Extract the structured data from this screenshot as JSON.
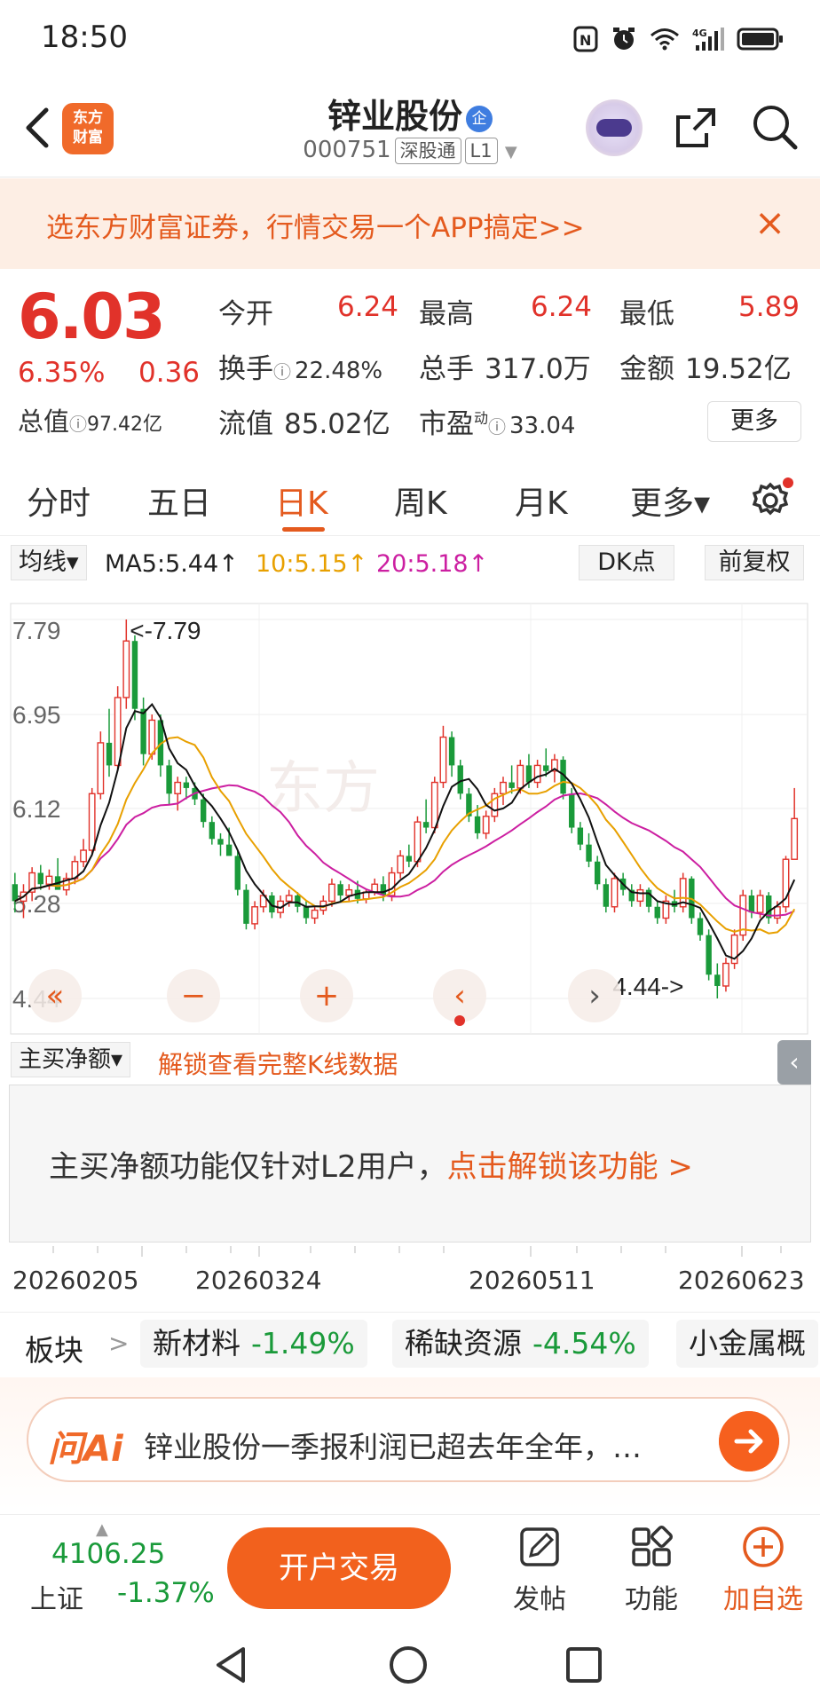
{
  "status_bar": {
    "time": "18:50",
    "network": "4G"
  },
  "nav": {
    "logo_text_line1": "东方",
    "logo_text_line2": "财富",
    "stock_name": "锌业股份",
    "badge": "企",
    "stock_code": "000751",
    "tag1": "深股通",
    "tag2": "L1"
  },
  "promo": {
    "text": "选东方财富证券，行情交易一个APP搞定>>",
    "close": "×"
  },
  "quote": {
    "price": "6.03",
    "change_pct": "6.35%",
    "change_amt": "0.36",
    "market_cap_label": "总值",
    "market_cap_value": "97.42亿",
    "open_label": "今开",
    "open_value": "6.24",
    "high_label": "最高",
    "high_value": "6.24",
    "low_label": "最低",
    "low_value": "5.89",
    "turnover_label": "换手",
    "turnover_value": "22.48%",
    "volume_label": "总手",
    "volume_value": "317.0万",
    "amount_label": "金额",
    "amount_value": "19.52亿",
    "float_cap_label": "流值",
    "float_cap_value": "85.02亿",
    "pe_label": "市盈",
    "pe_sup": "动",
    "pe_value": "33.04",
    "more_label": "更多"
  },
  "tabs": [
    {
      "label": "分时"
    },
    {
      "label": "五日"
    },
    {
      "label": "日K"
    },
    {
      "label": "周K"
    },
    {
      "label": "月K"
    },
    {
      "label": "更多▾"
    }
  ],
  "ma_bar": {
    "selector": "均线▾",
    "ma5": "MA5:5.44↑",
    "ma10": "10:5.15↑",
    "ma20": "20:5.18↑",
    "dk": "DK点",
    "adjust": "前复权"
  },
  "chart_data": {
    "type": "candlestick",
    "ylim": [
      4.44,
      7.79
    ],
    "y_ticks": [
      "7.79",
      "6.95",
      "6.12",
      "5.28",
      "4.44"
    ],
    "max_annotation": "<-7.79",
    "min_annotation": "4.44->",
    "x_tick_labels": [
      "20260205",
      "20260324",
      "20260511",
      "20260623"
    ],
    "series": [
      {
        "name": "MA5",
        "color": "#111111"
      },
      {
        "name": "10",
        "color": "#e8a000"
      },
      {
        "name": "20",
        "color": "#cc1fa1"
      }
    ],
    "candles": [
      [
        5.45,
        5.55,
        5.2,
        5.3
      ],
      [
        5.3,
        5.45,
        5.15,
        5.38
      ],
      [
        5.38,
        5.6,
        5.3,
        5.55
      ],
      [
        5.55,
        5.62,
        5.4,
        5.45
      ],
      [
        5.45,
        5.58,
        5.4,
        5.52
      ],
      [
        5.52,
        5.68,
        5.45,
        5.4
      ],
      [
        5.4,
        5.55,
        5.35,
        5.5
      ],
      [
        5.5,
        5.7,
        5.45,
        5.65
      ],
      [
        5.65,
        5.85,
        5.6,
        5.75
      ],
      [
        5.75,
        6.3,
        5.7,
        6.25
      ],
      [
        6.25,
        6.8,
        6.2,
        6.7
      ],
      [
        6.7,
        7.0,
        6.4,
        6.5
      ],
      [
        6.5,
        7.2,
        6.45,
        7.1
      ],
      [
        7.1,
        7.79,
        7.0,
        7.6
      ],
      [
        7.6,
        7.65,
        6.9,
        7.0
      ],
      [
        7.0,
        7.1,
        6.5,
        6.6
      ],
      [
        6.6,
        6.95,
        6.55,
        6.9
      ],
      [
        6.9,
        6.95,
        6.4,
        6.5
      ],
      [
        6.5,
        6.55,
        6.15,
        6.25
      ],
      [
        6.25,
        6.4,
        6.1,
        6.35
      ],
      [
        6.35,
        6.4,
        6.2,
        6.3
      ],
      [
        6.3,
        6.35,
        6.15,
        6.2
      ],
      [
        6.2,
        6.25,
        5.95,
        6.0
      ],
      [
        6.0,
        6.05,
        5.8,
        5.85
      ],
      [
        5.85,
        5.9,
        5.7,
        5.8
      ],
      [
        5.8,
        5.95,
        5.75,
        5.7
      ],
      [
        5.7,
        5.75,
        5.35,
        5.4
      ],
      [
        5.4,
        5.45,
        5.05,
        5.1
      ],
      [
        5.1,
        5.3,
        5.05,
        5.25
      ],
      [
        5.25,
        5.4,
        5.2,
        5.35
      ],
      [
        5.35,
        5.38,
        5.15,
        5.2
      ],
      [
        5.2,
        5.35,
        5.15,
        5.3
      ],
      [
        5.3,
        5.4,
        5.25,
        5.35
      ],
      [
        5.35,
        5.38,
        5.2,
        5.25
      ],
      [
        5.25,
        5.3,
        5.1,
        5.15
      ],
      [
        5.15,
        5.25,
        5.1,
        5.22
      ],
      [
        5.22,
        5.35,
        5.18,
        5.3
      ],
      [
        5.3,
        5.5,
        5.25,
        5.45
      ],
      [
        5.45,
        5.48,
        5.3,
        5.35
      ],
      [
        5.35,
        5.45,
        5.3,
        5.4
      ],
      [
        5.4,
        5.48,
        5.28,
        5.32
      ],
      [
        5.32,
        5.4,
        5.28,
        5.38
      ],
      [
        5.38,
        5.5,
        5.35,
        5.45
      ],
      [
        5.45,
        5.52,
        5.3,
        5.35
      ],
      [
        5.35,
        5.6,
        5.3,
        5.55
      ],
      [
        5.55,
        5.75,
        5.5,
        5.7
      ],
      [
        5.7,
        5.8,
        5.6,
        5.65
      ],
      [
        5.65,
        6.05,
        5.6,
        6.0
      ],
      [
        6.0,
        6.2,
        5.9,
        5.95
      ],
      [
        5.95,
        6.4,
        5.9,
        6.35
      ],
      [
        6.35,
        6.85,
        6.3,
        6.75
      ],
      [
        6.75,
        6.8,
        6.4,
        6.5
      ],
      [
        6.5,
        6.55,
        6.2,
        6.25
      ],
      [
        6.25,
        6.3,
        6.0,
        6.05
      ],
      [
        6.05,
        6.15,
        5.85,
        5.9
      ],
      [
        5.9,
        6.1,
        5.85,
        6.05
      ],
      [
        6.05,
        6.3,
        6.0,
        6.25
      ],
      [
        6.25,
        6.4,
        6.15,
        6.35
      ],
      [
        6.35,
        6.5,
        6.25,
        6.3
      ],
      [
        6.3,
        6.55,
        6.25,
        6.5
      ],
      [
        6.5,
        6.6,
        6.3,
        6.35
      ],
      [
        6.35,
        6.55,
        6.3,
        6.5
      ],
      [
        6.5,
        6.65,
        6.4,
        6.45
      ],
      [
        6.45,
        6.6,
        6.35,
        6.55
      ],
      [
        6.55,
        6.58,
        6.2,
        6.25
      ],
      [
        6.25,
        6.3,
        5.9,
        5.95
      ],
      [
        5.95,
        6.0,
        5.75,
        5.8
      ],
      [
        5.8,
        5.9,
        5.6,
        5.65
      ],
      [
        5.65,
        5.7,
        5.4,
        5.45
      ],
      [
        5.45,
        5.5,
        5.2,
        5.25
      ],
      [
        5.25,
        5.55,
        5.2,
        5.5
      ],
      [
        5.5,
        5.55,
        5.35,
        5.4
      ],
      [
        5.4,
        5.45,
        5.25,
        5.3
      ],
      [
        5.3,
        5.45,
        5.25,
        5.4
      ],
      [
        5.4,
        5.42,
        5.2,
        5.25
      ],
      [
        5.25,
        5.3,
        5.1,
        5.15
      ],
      [
        5.15,
        5.35,
        5.1,
        5.3
      ],
      [
        5.3,
        5.4,
        5.2,
        5.25
      ],
      [
        5.25,
        5.55,
        5.2,
        5.5
      ],
      [
        5.5,
        5.52,
        5.1,
        5.15
      ],
      [
        5.15,
        5.2,
        4.95,
        5.0
      ],
      [
        5.0,
        5.05,
        4.6,
        4.65
      ],
      [
        4.65,
        4.75,
        4.44,
        4.55
      ],
      [
        4.55,
        4.8,
        4.5,
        4.75
      ],
      [
        4.75,
        5.05,
        4.7,
        5.0
      ],
      [
        5.0,
        5.4,
        4.95,
        5.35
      ],
      [
        5.35,
        5.4,
        5.15,
        5.2
      ],
      [
        5.2,
        5.4,
        5.15,
        5.35
      ],
      [
        5.35,
        5.38,
        5.1,
        5.15
      ],
      [
        5.15,
        5.3,
        5.1,
        5.25
      ],
      [
        5.25,
        5.7,
        5.2,
        5.67
      ],
      [
        5.67,
        6.3,
        5.89,
        6.03
      ]
    ]
  },
  "chart_controls": [
    "«",
    "−",
    "+",
    "‹",
    "›"
  ],
  "netbuy": {
    "selector": "主买净额▾",
    "unlock": "解锁查看完整K线数据",
    "collapse": "‹",
    "msg": "主买净额功能仅针对L2用户，",
    "msg_link": "点击解锁该功能 >"
  },
  "dates": [
    "20260205",
    "20260324",
    "20260511",
    "20260623"
  ],
  "sectors": {
    "label": "板块",
    "arrow": ">",
    "items": [
      {
        "name": "新材料",
        "pct": "-1.49%"
      },
      {
        "name": "稀缺资源",
        "pct": "-4.54%"
      },
      {
        "name": "小金属概",
        "pct": ""
      }
    ]
  },
  "ai": {
    "logo": "问Ai",
    "text": "锌业股份一季报利润已超去年全年，…"
  },
  "bottom": {
    "index_value": "4106.25",
    "index_name": "上证",
    "index_pct": "-1.37%",
    "open_trade": "开户交易",
    "post": "发帖",
    "func": "功能",
    "add_watch": "加自选"
  },
  "colors": {
    "up": "#e1322a",
    "down": "#1a9a3a",
    "accent": "#e45a1e",
    "ma5": "#111111",
    "ma10": "#e8a000",
    "ma20": "#cc1fa1"
  }
}
